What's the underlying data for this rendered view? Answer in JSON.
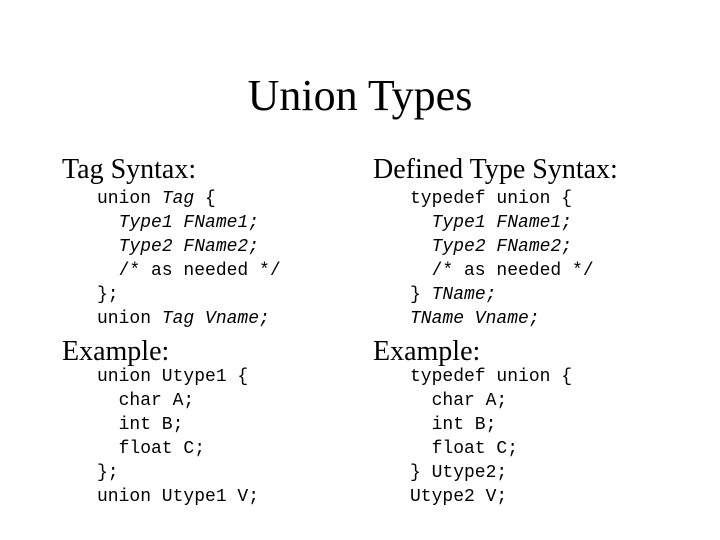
{
  "title": "Union Types",
  "left": {
    "heading": "Tag Syntax:",
    "code": [
      [
        {
          "t": "union "
        },
        {
          "t": "Tag",
          "i": true
        },
        {
          "t": " {"
        }
      ],
      [
        {
          "t": "  "
        },
        {
          "t": "Type1 FName1;",
          "i": true
        }
      ],
      [
        {
          "t": "  "
        },
        {
          "t": "Type2 FName2;",
          "i": true
        }
      ],
      [
        {
          "t": "  /* as needed */"
        }
      ],
      [
        {
          "t": "};"
        }
      ],
      [
        {
          "t": "union "
        },
        {
          "t": "Tag Vname;",
          "i": true
        }
      ]
    ],
    "example_heading": "Example:",
    "example_code": [
      [
        {
          "t": "union Utype1 {"
        }
      ],
      [
        {
          "t": "  char A;"
        }
      ],
      [
        {
          "t": "  int B;"
        }
      ],
      [
        {
          "t": "  float C;"
        }
      ],
      [
        {
          "t": "};"
        }
      ],
      [
        {
          "t": "union Utype1 V;"
        }
      ]
    ]
  },
  "right": {
    "heading": "Defined Type Syntax:",
    "code": [
      [
        {
          "t": "typedef union {"
        }
      ],
      [
        {
          "t": "  "
        },
        {
          "t": "Type1 FName1;",
          "i": true
        }
      ],
      [
        {
          "t": "  "
        },
        {
          "t": "Type2 FName2;",
          "i": true
        }
      ],
      [
        {
          "t": "  /* as needed */"
        }
      ],
      [
        {
          "t": "} "
        },
        {
          "t": "TName;",
          "i": true
        }
      ],
      [
        {
          "t": "TName Vname;",
          "i": true
        }
      ]
    ],
    "example_heading": "Example:",
    "example_code": [
      [
        {
          "t": "typedef union {"
        }
      ],
      [
        {
          "t": "  char A;"
        }
      ],
      [
        {
          "t": "  int B;"
        }
      ],
      [
        {
          "t": "  float C;"
        }
      ],
      [
        {
          "t": "} Utype2;"
        }
      ],
      [
        {
          "t": "Utype2 V;"
        }
      ]
    ]
  }
}
